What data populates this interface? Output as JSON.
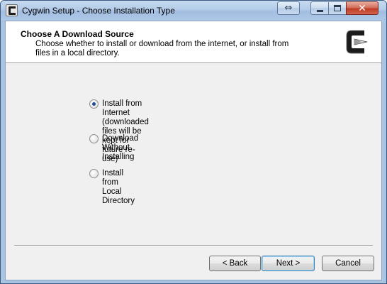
{
  "window": {
    "title": "Cygwin Setup - Choose Installation Type",
    "icon": "cygwin-icon",
    "controls": {
      "help_icon": "swap-arrows-icon",
      "help_glyph": "⇔",
      "minimize_icon": "minimize-icon",
      "maximize_icon": "maximize-icon",
      "close_icon": "close-icon",
      "close_glyph": "✕"
    }
  },
  "header": {
    "title": "Choose A Download Source",
    "description": "Choose whether to install or download from the internet, or install from files in a local directory.",
    "logo": "cygwin-logo"
  },
  "options": [
    {
      "label": "Install from Internet",
      "sublabel": "(downloaded files will be kept for future re-use)",
      "checked": true
    },
    {
      "label": "Download Without Installing",
      "checked": false
    },
    {
      "label": "Install from Local Directory",
      "checked": false
    }
  ],
  "buttons": {
    "back": "< Back",
    "next": "Next >",
    "cancel": "Cancel"
  },
  "colors": {
    "titlebar": "#b3cbe8",
    "client_bg": "#f0f0f0",
    "header_bg": "#ffffff",
    "default_button_border": "#3c7fb1"
  }
}
